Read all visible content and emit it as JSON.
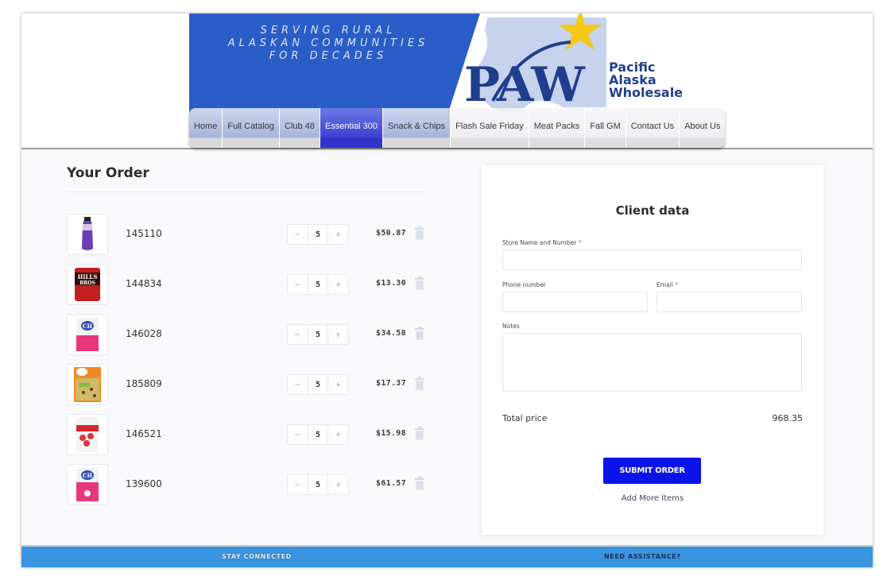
{
  "header": {
    "tagline_lines": [
      "SERVING RURAL",
      "ALASKAN COMMUNITIES",
      "FOR DECADES"
    ],
    "logo_monogram": "PAW",
    "logo_words": [
      "Pacific",
      "Alaska",
      "Wholesale"
    ],
    "colors": {
      "banner_blue": "#2a5dc8",
      "logo_navy": "#1f3f8c",
      "star_yellow": "#f4c816"
    }
  },
  "nav": {
    "items": [
      {
        "label": "Home",
        "active": false
      },
      {
        "label": "Full Catalog",
        "active": false
      },
      {
        "label": "Club 48",
        "active": false
      },
      {
        "label": "Essential 300",
        "active": true
      },
      {
        "label": "Snack & Chips",
        "active": false
      },
      {
        "label": "Flash Sale Friday",
        "active": false
      },
      {
        "label": "Meat Packs",
        "active": false
      },
      {
        "label": "Fall GM",
        "active": false
      },
      {
        "label": "Contact Us",
        "active": false
      },
      {
        "label": "About Us",
        "active": false
      }
    ]
  },
  "order": {
    "title": "Your Order",
    "items": [
      {
        "sku": "145110",
        "qty": "5",
        "price": "$50.87",
        "image": "purple-sports-drink-bottle"
      },
      {
        "sku": "144834",
        "qty": "5",
        "price": "$13.30",
        "image": "hills-bros-coffee-can"
      },
      {
        "sku": "146028",
        "qty": "5",
        "price": "$34.58",
        "image": "ch-sugar-bag"
      },
      {
        "sku": "185809",
        "qty": "5",
        "price": "$17.37",
        "image": "dino-pasta-box"
      },
      {
        "sku": "146521",
        "qty": "5",
        "price": "$15.98",
        "image": "frozen-strawberries-bag"
      },
      {
        "sku": "139600",
        "qty": "5",
        "price": "$61.57",
        "image": "ch-sugar-bag"
      }
    ],
    "minus_symbol": "−",
    "plus_symbol": "+"
  },
  "client": {
    "title": "Client data",
    "store_label": "Store Name and Number",
    "phone_label": "Phone number",
    "email_label": "Email",
    "notes_label": "Notes",
    "required_marker": "*",
    "store_value": "",
    "phone_value": "",
    "email_value": "",
    "notes_value": "",
    "total_label": "Total price",
    "total_value": "968.35",
    "submit_label": "SUBMIT ORDER",
    "add_more_label": "Add More Items",
    "colors": {
      "submit_bg": "#0a14e8",
      "required": "#e84a4a"
    }
  },
  "footer": {
    "left": "STAY CONNECTED",
    "right": "NEED ASSISTANCE?",
    "color": "#3b94e0"
  }
}
